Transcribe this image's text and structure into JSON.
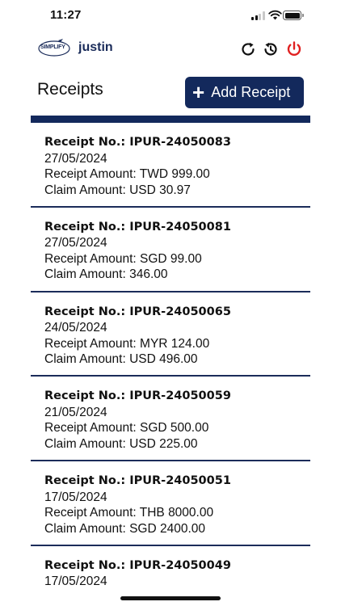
{
  "status_bar": {
    "time": "11:27"
  },
  "header": {
    "logo_text": "SIMPLIFY",
    "user_name": "justin"
  },
  "page": {
    "title": "Receipts",
    "add_button_label": "Add Receipt"
  },
  "receipts": [
    {
      "no_label": "Receipt No.: ",
      "no": "IPUR-24050083",
      "date": "27/05/2024",
      "receipt_amount": "Receipt Amount: TWD 999.00",
      "claim_amount": "Claim Amount: USD 30.97"
    },
    {
      "no_label": "Receipt No.: ",
      "no": "IPUR-24050081",
      "date": "27/05/2024",
      "receipt_amount": "Receipt Amount: SGD 99.00",
      "claim_amount": "Claim Amount:  346.00"
    },
    {
      "no_label": "Receipt No.: ",
      "no": "IPUR-24050065",
      "date": "24/05/2024",
      "receipt_amount": "Receipt Amount: MYR 124.00",
      "claim_amount": "Claim Amount: USD 496.00"
    },
    {
      "no_label": "Receipt No.: ",
      "no": "IPUR-24050059",
      "date": "21/05/2024",
      "receipt_amount": "Receipt Amount: SGD 500.00",
      "claim_amount": "Claim Amount: USD 225.00"
    },
    {
      "no_label": "Receipt No.: ",
      "no": "IPUR-24050051",
      "date": "17/05/2024",
      "receipt_amount": "Receipt Amount: THB 8000.00",
      "claim_amount": "Claim Amount: SGD 2400.00"
    },
    {
      "no_label": "Receipt No.: ",
      "no": "IPUR-24050049",
      "date": "17/05/2024",
      "receipt_amount": "",
      "claim_amount": ""
    }
  ],
  "colors": {
    "primary": "#13295c",
    "power": "#e02020"
  }
}
